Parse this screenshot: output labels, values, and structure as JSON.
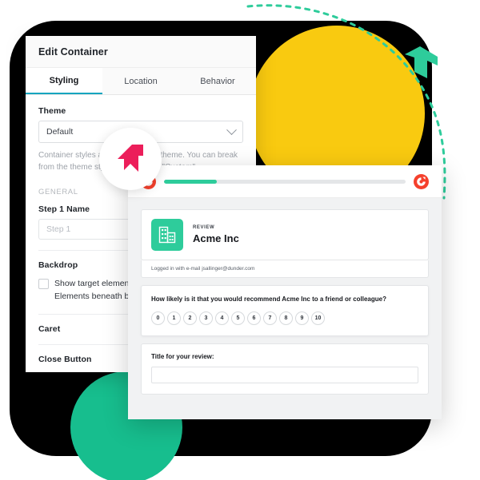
{
  "panel": {
    "title": "Edit Container",
    "tabs": [
      {
        "label": "Styling",
        "active": true
      },
      {
        "label": "Location",
        "active": false
      },
      {
        "label": "Behavior",
        "active": false
      }
    ],
    "theme": {
      "label": "Theme",
      "value": "Default",
      "chevron_icon": "chevron-down-icon"
    },
    "help_text": "Container styles are based on the theme. You can break from the theme styles by choosing \"Custom\".",
    "section_general": "GENERAL",
    "step_name": {
      "label": "Step 1 Name",
      "placeholder": "Step 1",
      "value": ""
    },
    "backdrop": {
      "label": "Backdrop",
      "checkbox_checked": false,
      "checkbox_line1": "Show target element above backdrop",
      "checkbox_line2": "Elements beneath backdrop are not clickable"
    },
    "caret": {
      "label": "Caret"
    },
    "close_button": {
      "label": "Close Button"
    }
  },
  "preview": {
    "topbar": {
      "left_logo_icon": "g2-logo-icon",
      "right_logo_icon": "g2-logo-icon",
      "progress_percent": 22
    },
    "company": {
      "logo_icon": "building-icon",
      "kicker": "REVIEW",
      "name": "Acme Inc"
    },
    "logged_in_text": "Logged in with e-mail jsallinger@dunder.com",
    "nps": {
      "question": "How likely is it that you would recommend Acme Inc to a friend or colleague?",
      "options": [
        "0",
        "1",
        "2",
        "3",
        "4",
        "5",
        "6",
        "7",
        "8",
        "9",
        "10"
      ]
    },
    "review_title": {
      "label": "Title for your review:",
      "value": "",
      "placeholder": ""
    }
  },
  "decor": {
    "black_shape": "#000000",
    "yellow_circle": "#F9CA10",
    "teal_circle": "#17BE8E",
    "teal_arrow_icon": "arrow-up-icon",
    "teal_arrow_color": "#2ECC9B",
    "dashed_trail_color": "#2ECC9B",
    "cursor_badge_icon": "cursor-arrow-icon",
    "cursor_badge_color": "#EC1E5A",
    "accent_tab": "#12A5BF",
    "g2_red": "#F5402C",
    "progress_green": "#2ECC9B"
  }
}
